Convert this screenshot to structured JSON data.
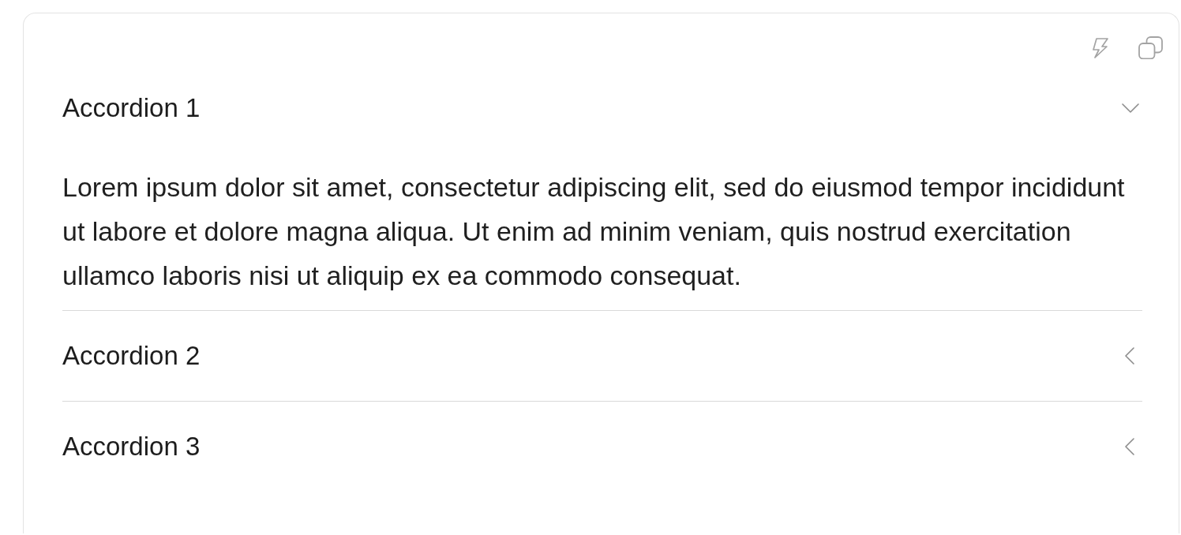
{
  "accordion": {
    "items": [
      {
        "title": "Accordion 1",
        "expanded": true,
        "body": "Lorem ipsum dolor sit amet, consectetur adipiscing elit, sed do eiusmod tempor incididunt ut labore et dolore magna aliqua. Ut enim ad minim veniam, quis nostrud exercitation ullamco laboris nisi ut aliquip ex ea commodo consequat."
      },
      {
        "title": "Accordion 2",
        "expanded": false
      },
      {
        "title": "Accordion 3",
        "expanded": false
      }
    ]
  }
}
